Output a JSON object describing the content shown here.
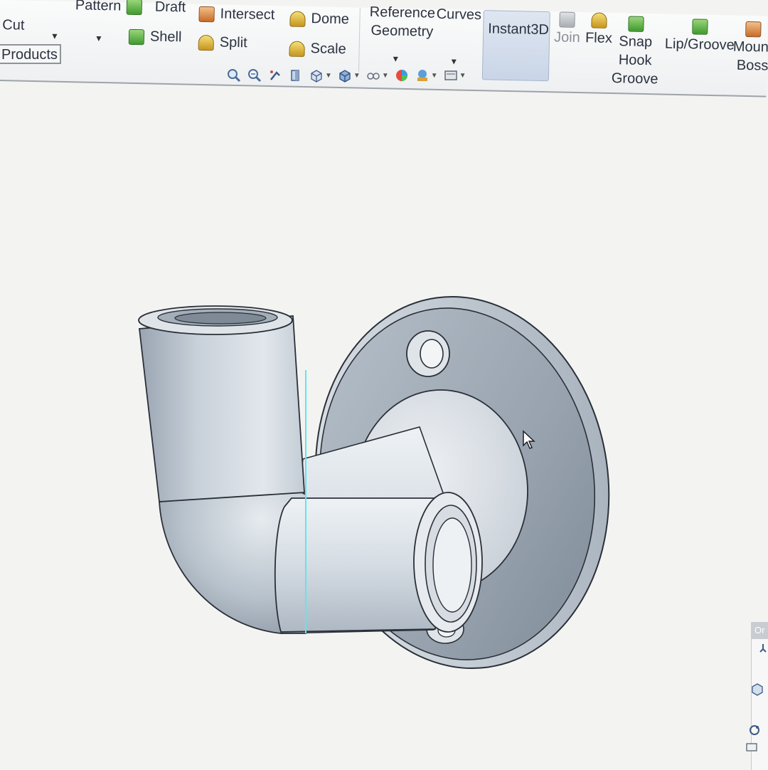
{
  "ribbon": {
    "cut": "Cut",
    "pattern": "Pattern",
    "draft": "Draft",
    "shell": "Shell",
    "intersect": "Intersect",
    "split": "Split",
    "dome": "Dome",
    "scale": "Scale",
    "reference_geometry_line1": "Reference",
    "reference_geometry_line2": "Geometry",
    "curves": "Curves",
    "instant3d": "Instant3D",
    "join": "Join",
    "flex": "Flex",
    "snap_hook_groove_line1": "Snap",
    "snap_hook_groove_line2": "Hook",
    "snap_hook_groove_line3": "Groove",
    "lip_groove": "Lip/Groove",
    "mount_boss_line1": "Mount",
    "mount_boss_line2": "Boss"
  },
  "tabs": {
    "products": "Products"
  },
  "heads_up_toolbar": [
    "zoom-to-fit-icon",
    "zoom-to-area-icon",
    "previous-view-icon",
    "section-view-icon",
    "view-orientation-icon",
    "display-style-icon",
    "hide-show-items-icon",
    "edit-appearance-icon",
    "apply-scene-icon",
    "view-settings-icon"
  ],
  "side_panel": {
    "title": "Or"
  },
  "colors": {
    "model_light": "#e4e9ee",
    "model_mid": "#b9c2cc",
    "model_dark": "#8d98a5",
    "model_edge": "#2b3038",
    "selection_highlight": "#5ee6f0",
    "instant3d_active": "#cdd8e9"
  }
}
